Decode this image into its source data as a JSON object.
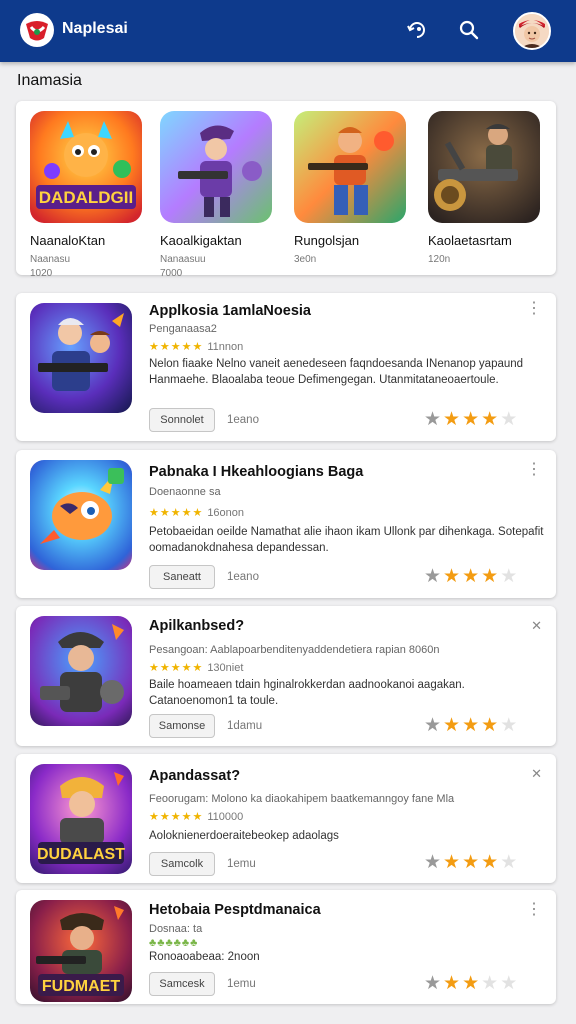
{
  "header": {
    "title": "Naplesai",
    "logo_icon": "brand-logo",
    "icons": [
      "refresh-icon",
      "search-icon",
      "avatar"
    ],
    "bg_color": "#0e3a8c"
  },
  "section": {
    "title": "Inamasia"
  },
  "featured": [
    {
      "name": "NaanaloKtan",
      "sub": "Naanasu",
      "count": "1020"
    },
    {
      "name": "Kaoalkigaktan",
      "sub": "Nanaasuu",
      "count": "7000"
    },
    {
      "name": "Rungolsjan",
      "sub": "3e0n",
      "count": ""
    },
    {
      "name": "Kaolaetasrtam",
      "sub": "120n",
      "count": ""
    }
  ],
  "apps": [
    {
      "title": "Applkosia 1amlaNoesia",
      "category": "Penganaasa2",
      "mini_stars": "★★★★★",
      "mini_count": "11nnon",
      "desc": "Nelon fiaake Nelno vaneit aenedeseen faqndoesanda INenanop yapaund Hanmaehe. Blaoalaba teoue Defimengegan. Utanmitataneoaertoule.",
      "button": "Sonnolet",
      "button_note": "1eano",
      "menu": "⋮",
      "rating": 3
    },
    {
      "title": "Pabnaka I Hkeahloogians Baga",
      "category": "Doenaonne sa",
      "mini_stars": "★★★★★",
      "mini_count": "16onon",
      "desc": "Petobaeidan oeilde Namathat alie ihaon ikam Ullonk par dihenkaga. Sotepafit oomadanokdnahesa depandessan.",
      "button": "Saneatt",
      "button_note": "1eano",
      "menu": "⋮",
      "rating": 3
    },
    {
      "title": "Apilkanbsed?",
      "category": "Pesangoan: Aablapoarbenditenyaddendetiera rapian 8060n",
      "mini_stars": "★★★★★",
      "mini_count": "130niet",
      "desc": "Baile hoameaen tdain hginalrokkerdan aadnookanoi aagakan. Catanoenomon1 ta toule.",
      "button": "Samonse",
      "button_note": "1damu",
      "menu": "✕",
      "rating": 3
    },
    {
      "title": "Apandassat?",
      "category": "Feoorugam: Molono ka diaokahipem baatkemanngoy fane Mla",
      "mini_stars": "★★★★★",
      "mini_count": "110000",
      "desc": "Aoloknienerdoeraitebeokep adaolags",
      "button": "Samcolk",
      "button_note": "1emu",
      "menu": "✕",
      "rating": 3
    },
    {
      "title": "Hetobaia Pesptdmanaica",
      "category": "Dosnaa: ta",
      "mini_stars": "♣♣♣♣♣♣",
      "mini_count": "",
      "desc": "Ronoaoabeaa: 2noon",
      "button": "Samcesk",
      "button_note": "1emu",
      "menu": "⋮",
      "rating": 2
    }
  ],
  "colors": {
    "star_gold": "#f39c12",
    "star_grey": "#999999",
    "star_empty": "#e2e2e2"
  }
}
